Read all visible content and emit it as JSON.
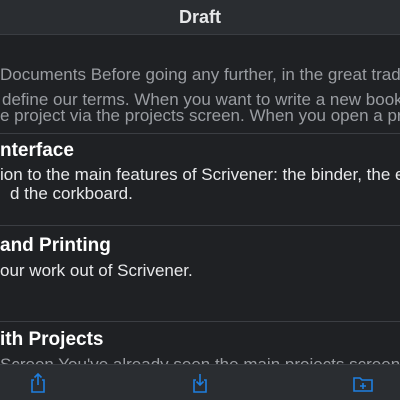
{
  "navbar": {
    "title": "Draft"
  },
  "documents": [
    {
      "title": "",
      "lines": [
        "Documents Before going any further, in the great tradit",
        "define our terms. When you want to write a new book o",
        "e project via the projects screen. When you open a proje"
      ]
    },
    {
      "title": "nterface",
      "lines": [
        "ion to the main features of Scrivener: the binder, the ed",
        "d the corkboard."
      ]
    },
    {
      "title": "and Printing",
      "lines": [
        "our work out of Scrivener."
      ]
    },
    {
      "title": "ith Projects",
      "lines": [
        "Screen You've already seen the main projects screen"
      ]
    }
  ],
  "toolbar": {
    "buttons": [
      {
        "icon": "share-icon"
      },
      {
        "icon": "import-icon"
      },
      {
        "icon": "new-folder-icon"
      }
    ]
  }
}
